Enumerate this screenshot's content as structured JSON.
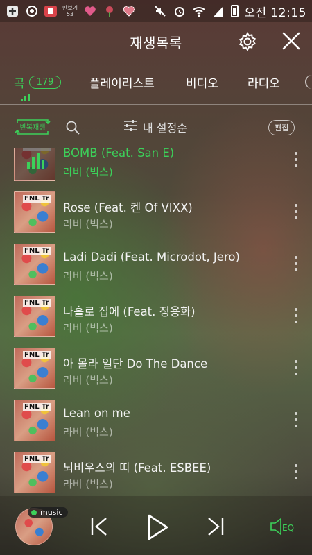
{
  "status_bar": {
    "steps_label": "만보기",
    "steps_value": "53",
    "time": "오전 12:15",
    "icons": [
      "plus-box-icon",
      "record-icon",
      "app-badge-icon",
      "heart-icon",
      "flower-icon",
      "heart-pattern-icon",
      "mute-icon",
      "alarm-icon",
      "wifi-icon",
      "signal-icon",
      "battery-icon"
    ]
  },
  "header": {
    "title": "재생목록",
    "settings_icon": "gear-icon",
    "close_icon": "close-icon"
  },
  "tabs": [
    {
      "label": "곡",
      "count": "179",
      "active": true
    },
    {
      "label": "플레이리스트"
    },
    {
      "label": "비디오"
    },
    {
      "label": "라디오"
    }
  ],
  "toolbar": {
    "repeat_label": "반복재생",
    "sort_label": "내 설정순",
    "edit_label": "편집"
  },
  "songs": [
    {
      "title": "BOMB (Feat. San E)",
      "artist": "라비 (빅스)",
      "active": true
    },
    {
      "title": "Rose (Feat. 켄 Of VIXX)",
      "artist": "라비 (빅스)"
    },
    {
      "title": "Ladi Dadi (Feat. Microdot, Jero)",
      "artist": "라비 (빅스)"
    },
    {
      "title": "나홀로 집에 (Feat. 정용화)",
      "artist": "라비 (빅스)"
    },
    {
      "title": "아 몰라 일단 Do The Dance",
      "artist": "라비 (빅스)"
    },
    {
      "title": "Lean on me",
      "artist": "라비 (빅스)"
    },
    {
      "title": "뇌비우스의 띠 (Feat. ESBEE)",
      "artist": "라비 (빅스)"
    }
  ],
  "album_badge": "FNL Tr",
  "player": {
    "badge_label": "music",
    "eq_label": "EQ"
  },
  "colors": {
    "accent": "#3cd15a"
  }
}
